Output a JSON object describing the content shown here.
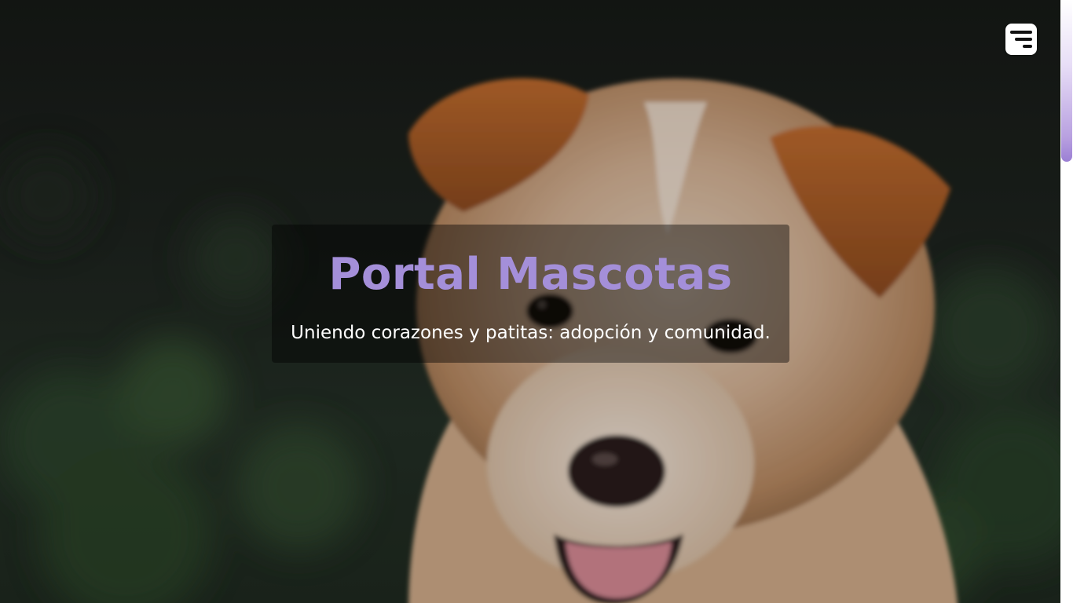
{
  "hero": {
    "title": "Portal Mascotas",
    "subtitle": "Uniendo corazones y patitas: adopción y comunidad.",
    "image_subject": "puppy"
  },
  "menu": {
    "icon": "menu-icon"
  },
  "colors": {
    "title": "#a48fd9",
    "subtitle": "#ffffff",
    "scroll_thumb": "#9b7fd4",
    "menu_button_bg": "#ffffff"
  }
}
